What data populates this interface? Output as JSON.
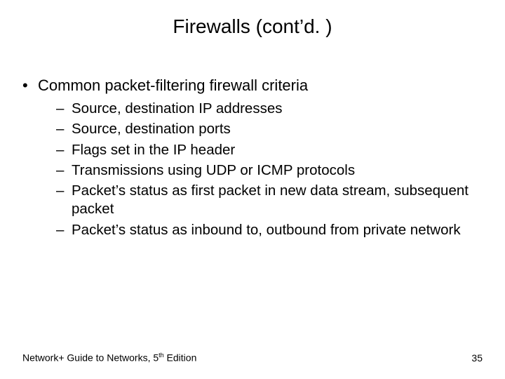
{
  "title": "Firewalls (cont’d. )",
  "bullets": [
    {
      "text": "Common packet-filtering firewall criteria",
      "sub": [
        "Source, destination IP addresses",
        "Source, destination ports",
        "Flags set in the IP header",
        "Transmissions using UDP or ICMP protocols",
        "Packet’s status as first packet in new data stream, subsequent packet",
        "Packet’s status as inbound to, outbound from private network"
      ]
    }
  ],
  "footer": {
    "part1": "Network+ Guide to Networks, 5",
    "sup": "th",
    "part2": " Edition"
  },
  "page": "35"
}
